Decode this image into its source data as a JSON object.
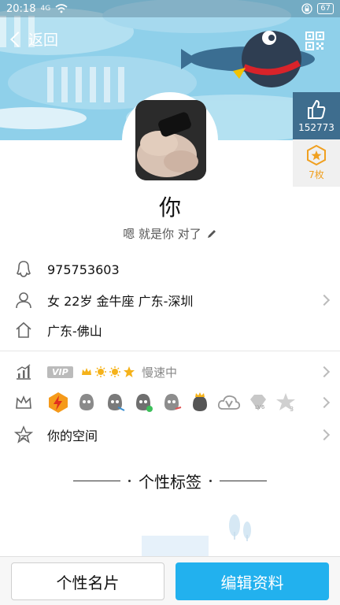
{
  "status_bar": {
    "time": "20:18",
    "network": "4G",
    "battery": "67"
  },
  "header": {
    "back_label": "返回"
  },
  "like": {
    "count": "152773"
  },
  "badge": {
    "count": "7枚"
  },
  "profile": {
    "nickname": "你",
    "signature": "嗯 就是你 对了"
  },
  "info": {
    "qq_number": "975753603",
    "details": "女  22岁  金牛座  广东-深圳",
    "hometown": "广东-佛山"
  },
  "vip": {
    "tag": "VIP",
    "speed_text": "慢速中"
  },
  "space": {
    "label": "你的空间"
  },
  "tags_section": {
    "title": "个性标签"
  },
  "bottom": {
    "card_label": "个性名片",
    "edit_label": "编辑资料"
  },
  "colors": {
    "accent": "#22b1ee",
    "cover_bg": "#8fd0ea",
    "like_bg": "#3e6d8e",
    "badge_star": "#f0a020"
  }
}
